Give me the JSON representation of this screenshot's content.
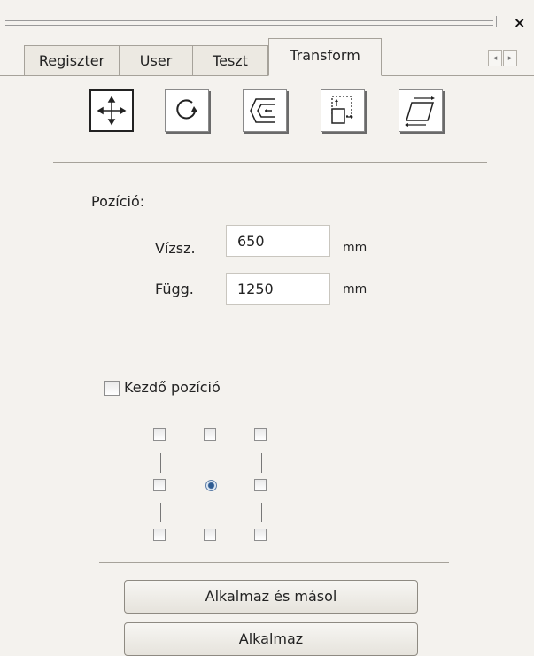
{
  "tabs": [
    "Regiszter",
    "User",
    "Teszt",
    "Transform"
  ],
  "active_tab": "Transform",
  "close_glyph": "×",
  "scroll_left_glyph": "◂",
  "scroll_right_glyph": "▸",
  "tools": [
    "move-icon",
    "rotate-icon",
    "scale-icon",
    "size-icon",
    "skew-icon"
  ],
  "position": {
    "section_label": "Pozíció:",
    "horizontal_label": "Vízsz.",
    "horizontal_value": "650",
    "horizontal_unit": "mm",
    "vertical_label": "Függ.",
    "vertical_value": "1250",
    "vertical_unit": "mm"
  },
  "start_position": {
    "label": "Kezdő pozíció",
    "checked": false,
    "selected_anchor": "center"
  },
  "buttons": {
    "apply_copy": "Alkalmaz és másol",
    "apply": "Alkalmaz"
  }
}
